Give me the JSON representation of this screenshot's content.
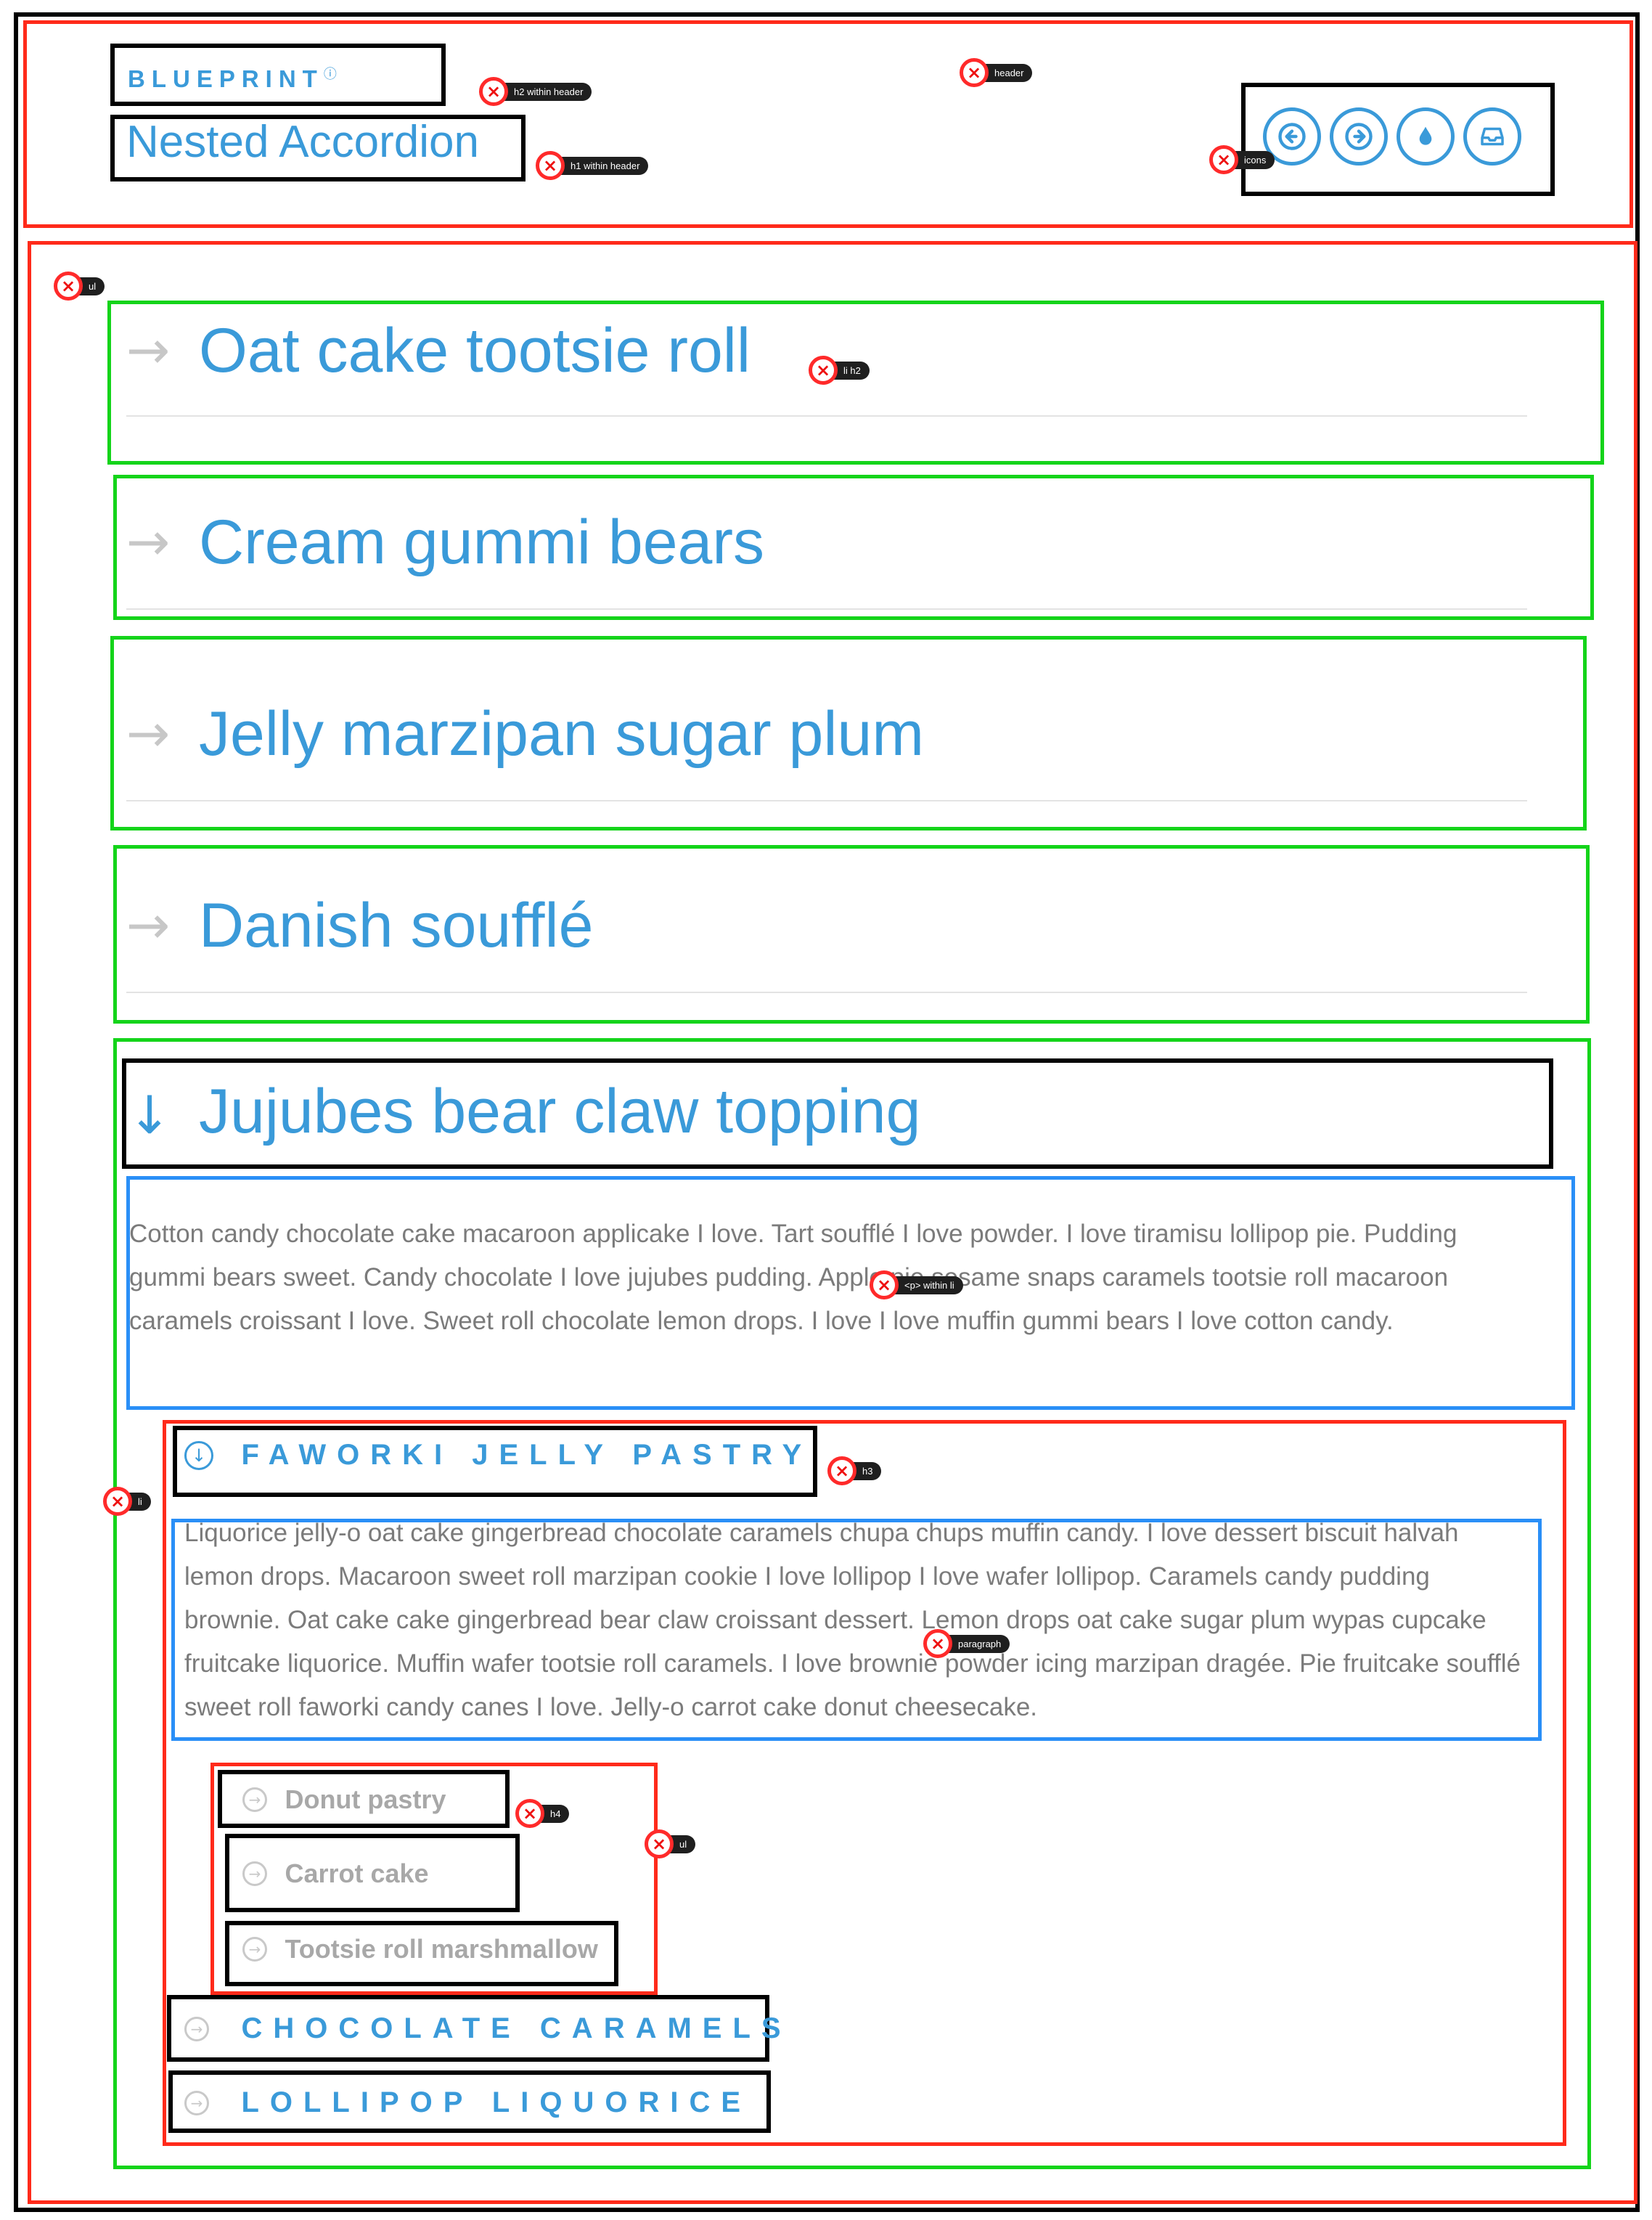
{
  "header": {
    "eyebrow": "BLUEPRINT",
    "help_glyph": "?",
    "title": "Nested Accordion",
    "icons": [
      "arrow-left-icon",
      "arrow-right-icon",
      "droplet-icon",
      "inbox-icon"
    ]
  },
  "annotations": {
    "header": "header",
    "h2_header": "h2 within header",
    "h1_header": "h1 within header",
    "icons": "icons",
    "ul": "ul",
    "li_h2": "li h2",
    "p_li": "<p> within li",
    "li": "li",
    "h3": "h3",
    "paragraph": "paragraph",
    "h4": "h4",
    "ul2": "ul"
  },
  "accordion": {
    "items": [
      {
        "title": "Oat cake tootsie roll"
      },
      {
        "title": "Cream gummi bears"
      },
      {
        "title": "Jelly marzipan sugar plum"
      },
      {
        "title": "Danish soufflé"
      },
      {
        "title": "Jujubes bear claw topping"
      }
    ],
    "open_paragraph": "Cotton candy chocolate cake macaroon applicake I love. Tart soufflé I love powder. I love tiramisu lollipop pie. Pudding gummi bears sweet. Candy chocolate I love jujubes pudding. Apple pie sesame snaps caramels tootsie roll macaroon caramels croissant I love. Sweet roll chocolate lemon drops. I love I love muffin gummi bears I love cotton candy.",
    "nested": {
      "open_h3": "FAWORKI JELLY PASTRY",
      "paragraph": "Liquorice jelly-o oat cake gingerbread chocolate caramels chupa chups muffin candy. I love dessert biscuit halvah lemon drops. Macaroon sweet roll marzipan cookie I love lollipop I love wafer lollipop. Caramels candy pudding brownie. Oat cake cake gingerbread bear claw croissant dessert. Lemon drops oat cake sugar plum wypas cupcake fruitcake liquorice. Muffin wafer tootsie roll caramels. I love brownie powder icing marzipan dragée. Pie fruitcake soufflé sweet roll faworki candy canes I love. Jelly-o carrot cake donut cheesecake.",
      "sub_items": [
        "Donut pastry",
        "Carrot cake",
        "Tootsie roll marshmallow"
      ],
      "h3_items": [
        "CHOCOLATE CARAMELS",
        "LOLLIPOP LIQUORICE"
      ]
    }
  },
  "colors": {
    "accent": "#3a9ad9",
    "annotation_red": "#ff2a1a",
    "annotation_green": "#14d41a",
    "annotation_blue": "#2a8ff7"
  }
}
